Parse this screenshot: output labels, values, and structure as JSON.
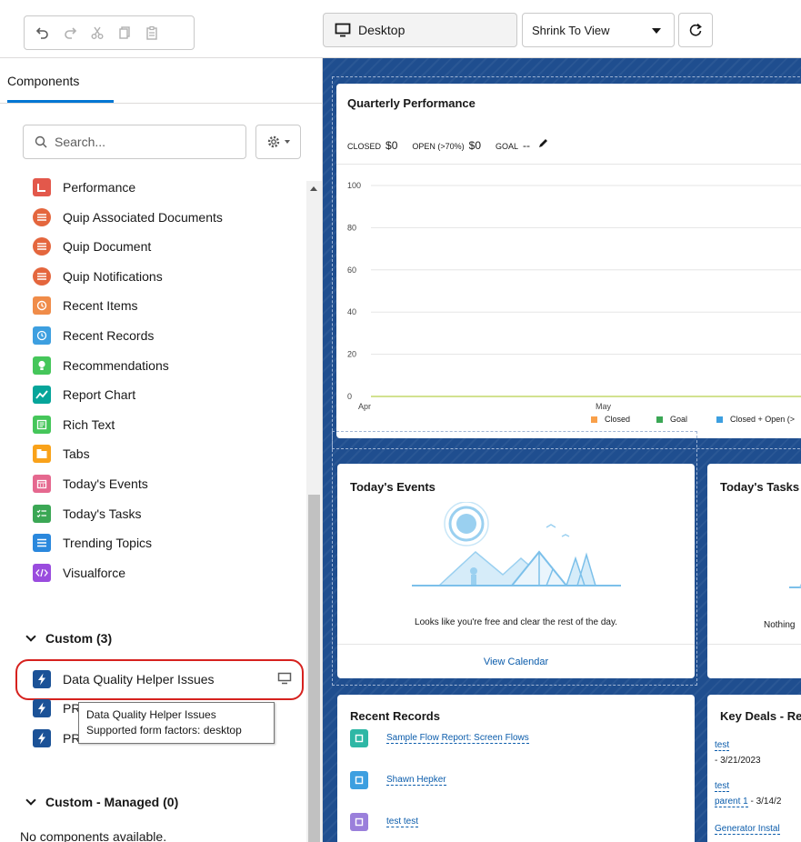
{
  "toolbar": {
    "device_label": "Desktop",
    "view_mode": "Shrink To View"
  },
  "left_panel": {
    "tab_label": "Components",
    "search_placeholder": "Search...",
    "components": [
      {
        "label": "Performance",
        "icon": "performance-icon",
        "color": "#e3584b"
      },
      {
        "label": "Quip Associated Documents",
        "icon": "quip-icon",
        "color": "#e4663d"
      },
      {
        "label": "Quip Document",
        "icon": "quip-icon",
        "color": "#e4663d"
      },
      {
        "label": "Quip Notifications",
        "icon": "quip-icon",
        "color": "#e4663d"
      },
      {
        "label": "Recent Items",
        "icon": "clock-icon",
        "color": "#f08c49"
      },
      {
        "label": "Recent Records",
        "icon": "history-icon",
        "color": "#3d9fe0"
      },
      {
        "label": "Recommendations",
        "icon": "lightbulb-icon",
        "color": "#45c65a"
      },
      {
        "label": "Report Chart",
        "icon": "chart-icon",
        "color": "#06a59a"
      },
      {
        "label": "Rich Text",
        "icon": "rich-text-icon",
        "color": "#45c65a"
      },
      {
        "label": "Tabs",
        "icon": "tabs-icon",
        "color": "#f9a21a"
      },
      {
        "label": "Today's Events",
        "icon": "calendar-icon",
        "color": "#e5688f"
      },
      {
        "label": "Today's Tasks",
        "icon": "task-icon",
        "color": "#3ba755"
      },
      {
        "label": "Trending Topics",
        "icon": "list-icon",
        "color": "#2a88dd"
      },
      {
        "label": "Visualforce",
        "icon": "code-icon",
        "color": "#9a4cde"
      }
    ],
    "custom_section": "Custom (3)",
    "custom_items": [
      {
        "label": "Data Quality Helper Issues",
        "icon": "lightning-icon"
      },
      {
        "label": "PR",
        "icon": "lightning-icon"
      },
      {
        "label": "PR",
        "icon": "lightning-icon"
      }
    ],
    "tooltip_title": "Data Quality Helper Issues",
    "tooltip_detail": "Supported form factors: desktop",
    "managed_section": "Custom - Managed (0)",
    "no_components": "No components available."
  },
  "canvas": {
    "quarterly": {
      "title": "Quarterly Performance",
      "closed_label": "CLOSED",
      "closed_value": "$0",
      "open_label": "OPEN (>70%)",
      "open_value": "$0",
      "goal_label": "GOAL",
      "goal_value": "--"
    },
    "legend": [
      {
        "label": "Closed",
        "color": "#f9a04a"
      },
      {
        "label": "Goal",
        "color": "#3ba755"
      },
      {
        "label": "Closed + Open (>",
        "color": "#3d9fe0"
      }
    ],
    "events": {
      "title": "Today's Events",
      "message": "Looks like you're free and clear the rest of the day.",
      "link": "View Calendar"
    },
    "tasks": {
      "title": "Today's Tasks",
      "message": "Nothing"
    },
    "recent_records": {
      "title": "Recent Records",
      "items": [
        {
          "label": "Sample Flow Report: Screen Flows",
          "icon": "report-icon",
          "color": "#2eb7a5"
        },
        {
          "label": "Shawn Hepker",
          "icon": "contact-icon",
          "color": "#3d9fe0"
        },
        {
          "label": "test test",
          "icon": "lead-icon",
          "color": "#9a7fdb"
        }
      ]
    },
    "key_deals": {
      "title": "Key Deals - Re",
      "deals": [
        {
          "name": "test",
          "date": "- 3/21/2023"
        },
        {
          "name": "test",
          "name2": "parent 1",
          "date": "- 3/14/2"
        },
        {
          "name": "Generator Instal"
        }
      ]
    }
  },
  "chart_data": {
    "type": "line",
    "title": "",
    "xlabel": "",
    "ylabel": "",
    "categories": [
      "Apr",
      "May"
    ],
    "ylim": [
      0,
      100
    ],
    "yticks": [
      0,
      20,
      40,
      60,
      80,
      100
    ],
    "series": [
      {
        "name": "Goal",
        "values": [
          0,
          0
        ],
        "color": "#c3d86b"
      }
    ],
    "grid": true,
    "legend": "bottom-right"
  }
}
